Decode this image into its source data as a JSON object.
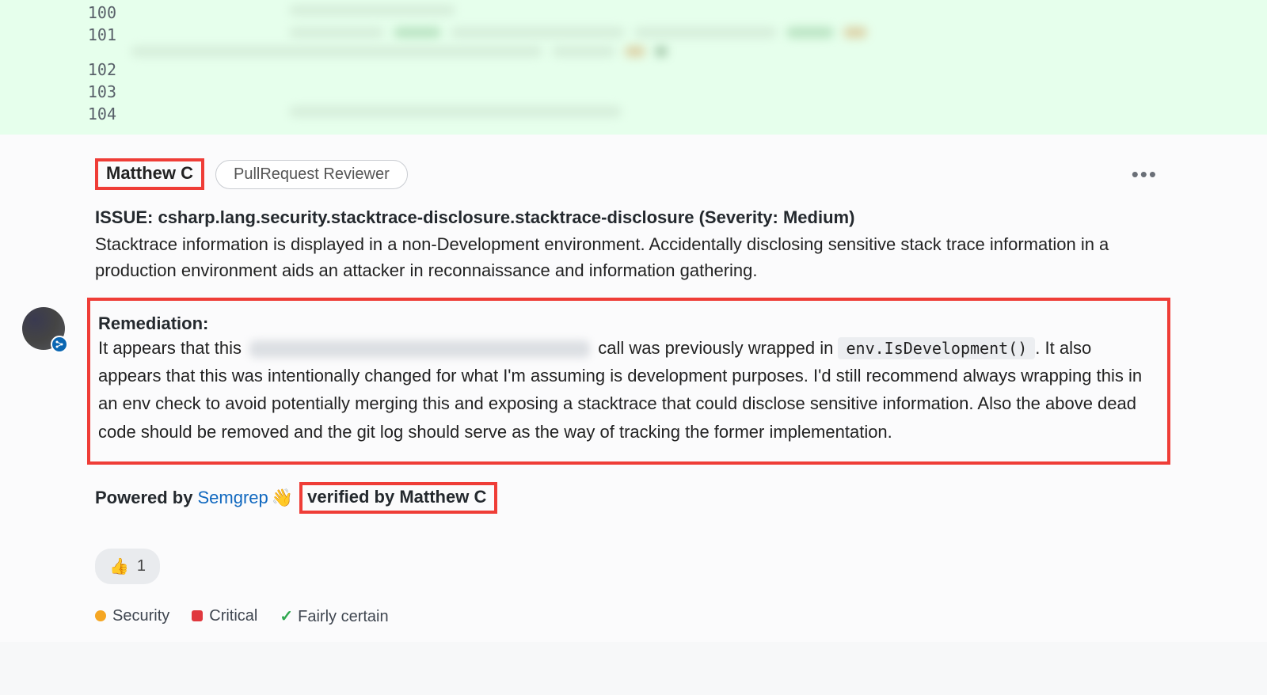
{
  "diff": {
    "lines": [
      "100",
      "101",
      "102",
      "103",
      "104"
    ]
  },
  "comment": {
    "author": "Matthew C",
    "role": "PullRequest Reviewer",
    "issue_title": "ISSUE: csharp.lang.security.stacktrace-disclosure.stacktrace-disclosure (Severity: Medium)",
    "issue_description": "Stacktrace information is displayed in a non-Development environment. Accidentally disclosing sensitive stack trace information in a production environment aids an attacker in reconnaissance and information gathering.",
    "remediation_title": "Remediation",
    "remediation_pre": "It appears that this ",
    "remediation_mid1": " call was previously wrapped in ",
    "remediation_code": "env.IsDevelopment()",
    "remediation_post": ". It also appears that this was intentionally changed for what I'm assuming is development purposes. I'd still recommend always wrapping this in an env check to avoid potentially merging this and exposing a stacktrace that could disclose sensitive information. Also the above dead code should be removed and the git log should serve as the way of tracking the former implementation.",
    "powered_by_label": "Powered by",
    "semgrep": "Semgrep",
    "wave": "👋",
    "verified_text": "verified by Matthew C",
    "reaction_emoji": "👍",
    "reaction_count": "1",
    "tags": {
      "security": {
        "label": "Security",
        "color": "#f5a623"
      },
      "critical": {
        "label": "Critical",
        "color": "#e0383e"
      },
      "fairly": {
        "label": "Fairly certain"
      }
    }
  }
}
